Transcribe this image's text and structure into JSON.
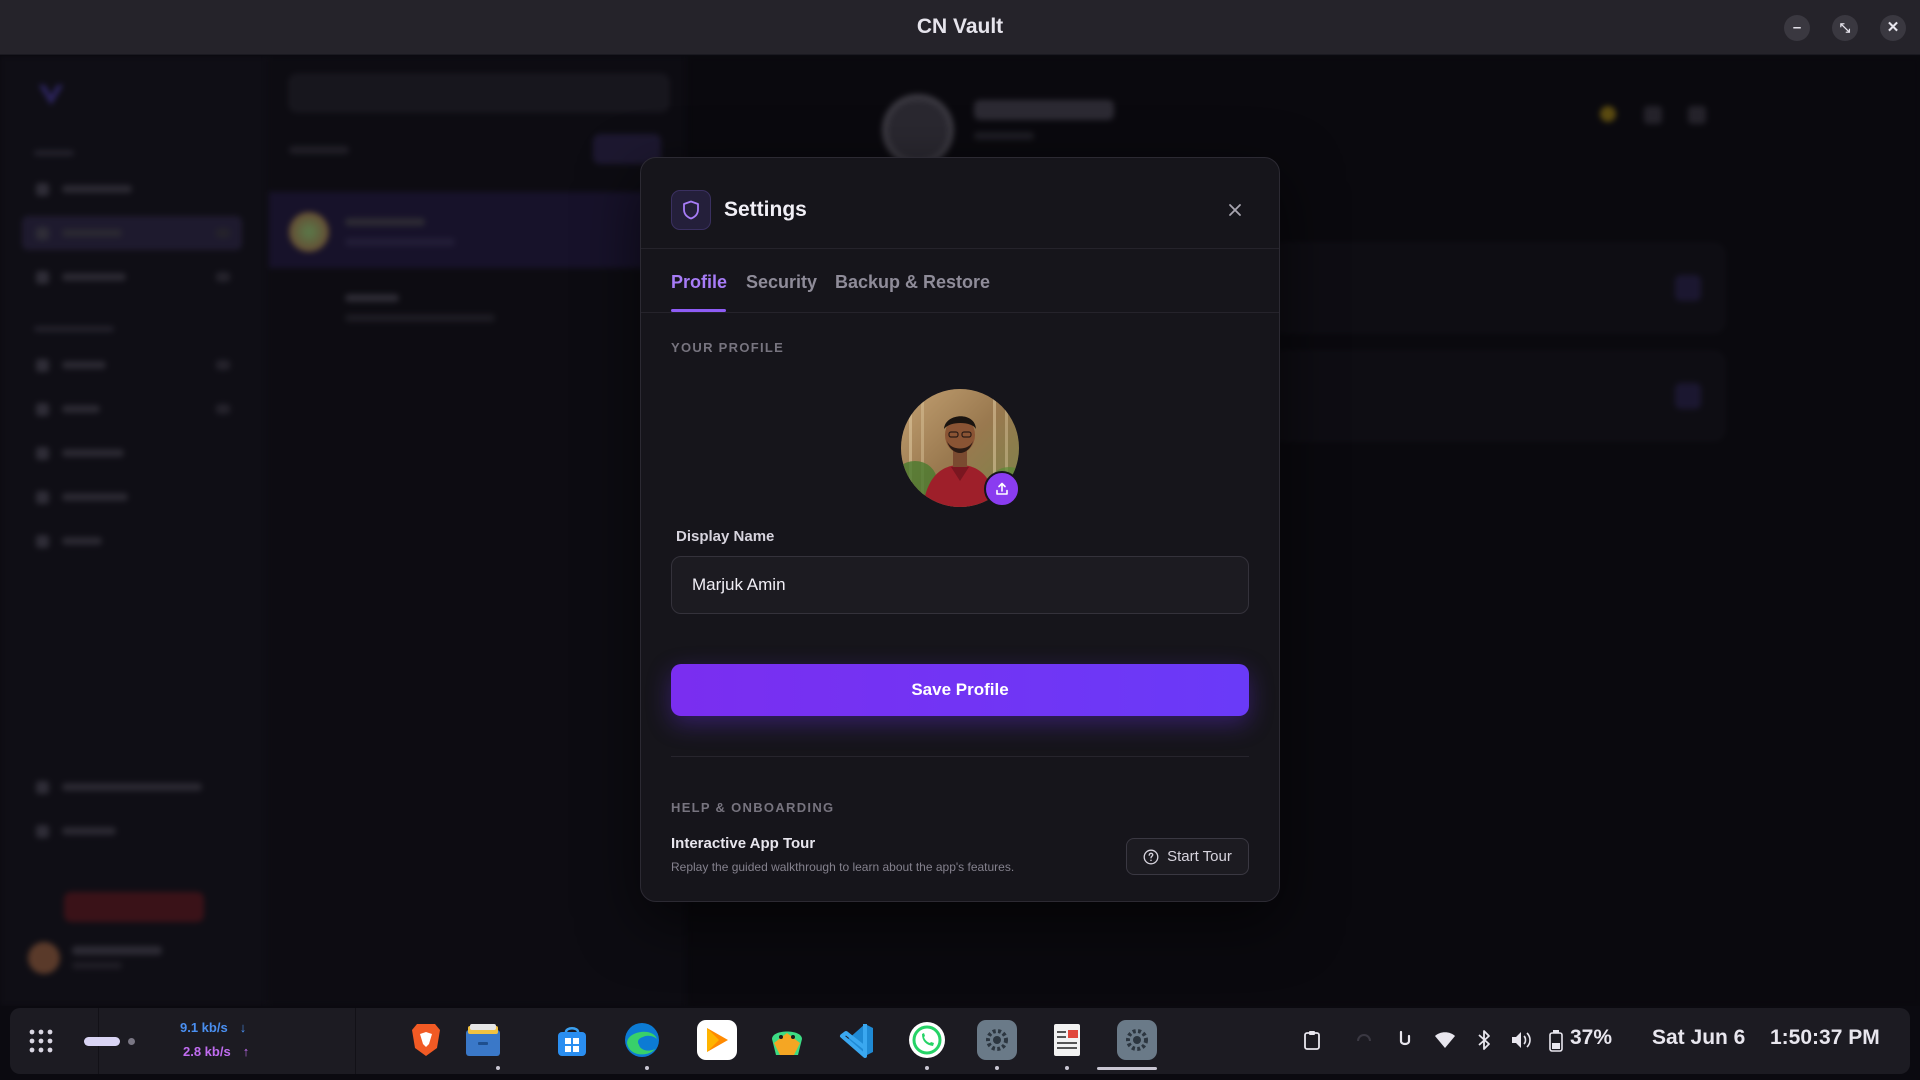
{
  "window": {
    "title": "CN Vault",
    "minimize": "–",
    "restore": "⤡",
    "close": "✕"
  },
  "colors": {
    "accent": "#8e5cf5",
    "accent_text": "#a77cf7",
    "button_gradient_start": "#7a2ef0",
    "button_gradient_end": "#6a3af8"
  },
  "settings": {
    "title": "Settings",
    "tabs": [
      {
        "label": "Profile",
        "active": true
      },
      {
        "label": "Security",
        "active": false
      },
      {
        "label": "Backup & Restore",
        "active": false
      }
    ],
    "profile": {
      "section_label": "YOUR PROFILE",
      "display_name_label": "Display Name",
      "display_name_value": "Marjuk Amin",
      "display_name_placeholder": "Display Name",
      "save_label": "Save Profile"
    },
    "help": {
      "section_label": "HELP & ONBOARDING",
      "tour_title": "Interactive App Tour",
      "tour_desc": "Replay the guided walkthrough to learn about the app's features.",
      "tour_button": "Start Tour"
    }
  },
  "taskbar": {
    "net_down": "9.1 kb/s",
    "net_up": "2.8 kb/s",
    "apps": [
      "brave-browser",
      "files",
      "software-store",
      "edge-browser",
      "play-store",
      "android-studio",
      "vscode",
      "whatsapp",
      "settings-app",
      "text-editor",
      "settings-active"
    ],
    "battery": "37%",
    "date": "Sat Jun 6",
    "time": "1:50:37 PM"
  }
}
